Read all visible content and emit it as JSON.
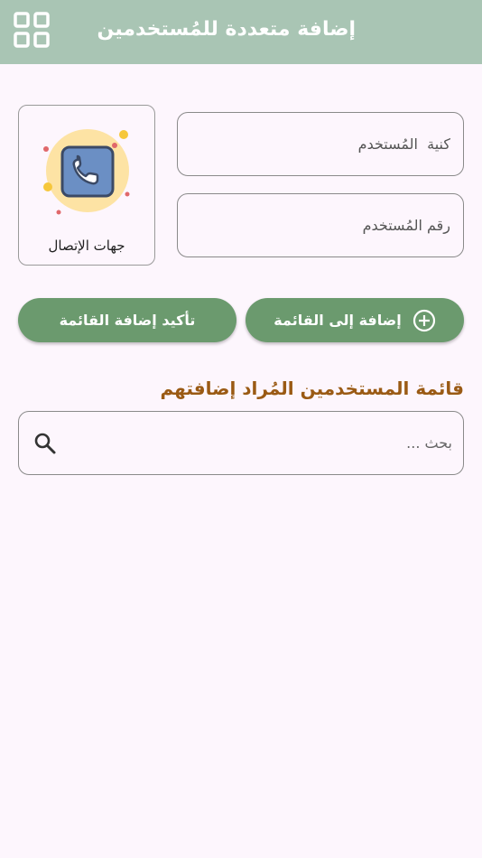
{
  "appbar": {
    "title": "إضافة متعددة للمُستخدمين",
    "menu_icon": "grid-icon",
    "background": "#a9c5b4"
  },
  "form": {
    "nickname_placeholder": "كنية  المُستخدم",
    "number_placeholder": "رقم المُستخدم"
  },
  "contacts": {
    "label": "جهات الإتصال",
    "icon": "phone-contacts-icon"
  },
  "buttons": {
    "add_to_list": "إضافة إلى القائمة",
    "confirm_add": "تأكيد إضافة القائمة",
    "add_icon": "plus-circle-icon",
    "color": "#6b9a6e"
  },
  "list": {
    "title": "قائمة المستخدمين المُراد إضافتهم",
    "title_color": "#9a5a14",
    "search_placeholder": "بحث ...",
    "search_icon": "search-icon"
  }
}
